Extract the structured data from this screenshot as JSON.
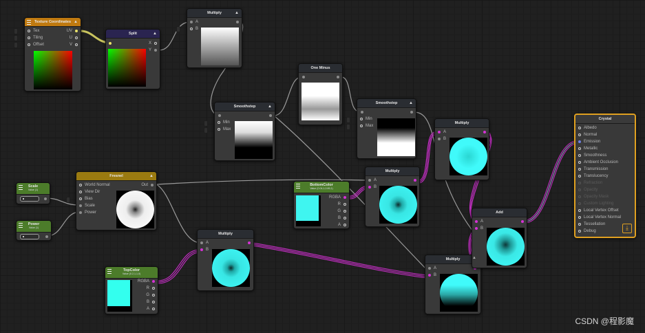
{
  "nodes": {
    "texcoord": {
      "title": "Texture Coordinates",
      "ports_in": [
        "Tex",
        "Tiling",
        "Offset"
      ],
      "ports_out": [
        "UV",
        "U",
        "V"
      ]
    },
    "split": {
      "title": "Split",
      "ports_out": [
        "X",
        "Y"
      ]
    },
    "multiply1": {
      "title": "Multiply",
      "ports_in": [
        "A",
        "B"
      ]
    },
    "oneminus": {
      "title": "One Minus"
    },
    "smoothstep1": {
      "title": "Smoothstep",
      "ports_in": [
        "Min",
        "Max"
      ]
    },
    "smoothstep2": {
      "title": "Smoothstep",
      "ports_in": [
        "Min",
        "Max"
      ]
    },
    "multiply_top": {
      "title": "Multiply",
      "ports_in": [
        "A",
        "B"
      ]
    },
    "fresnel": {
      "title": "Fresnel",
      "ports_in": [
        "World Normal",
        "View Dir",
        "Bias",
        "Scale",
        "Power"
      ],
      "ports_out": [
        "Out"
      ]
    },
    "scale": {
      "title": "Scale",
      "subtitle": "Value (1)"
    },
    "power": {
      "title": "Power",
      "subtitle": "Value (1)"
    },
    "bottomcolor": {
      "title": "BottomColor",
      "subtitle": "Value (0.04,1,0.89,1)",
      "ports_out": [
        "RGBA",
        "R",
        "G",
        "B",
        "A"
      ]
    },
    "multiply_mid": {
      "title": "Multiply",
      "ports_in": [
        "A",
        "B"
      ]
    },
    "multiply_fresnel": {
      "title": "Multiply",
      "ports_in": [
        "A",
        "B"
      ]
    },
    "topcolor": {
      "title": "TopColor",
      "subtitle": "Value (0.2,1,1,0)",
      "ports_out": [
        "RGBA",
        "R",
        "G",
        "B",
        "A"
      ]
    },
    "multiply_bottom": {
      "title": "Multiply",
      "ports_in": [
        "A",
        "B"
      ]
    },
    "add": {
      "title": "Add",
      "ports_in": [
        "A",
        "B"
      ]
    },
    "master": {
      "title": "Crystal",
      "ports": [
        "Albedo",
        "Normal",
        "Emission",
        "Metallic",
        "Smoothness",
        "Ambient Occlusion",
        "Transmission",
        "Translucency",
        "Refraction",
        "Opacity",
        "Opacity Mask",
        "Custom Lighting",
        "Local Vertex Offset",
        "Local Vertex Normal",
        "Tessellation",
        "Debug"
      ]
    }
  },
  "chips": {
    "tex": "",
    "tiling": "",
    "offset": "",
    "b1": "",
    "min1": "",
    "max1": "",
    "min2": "",
    "max2": "",
    "bias": ""
  },
  "watermark": "CSDN @程影魔",
  "colors": {
    "cyan": "#3ff5f0",
    "magenta_wire": "#c32ec3",
    "grey_wire": "#9a9a9a",
    "yellow_wire": "#e8e26a",
    "master_border": "#e0a020"
  }
}
